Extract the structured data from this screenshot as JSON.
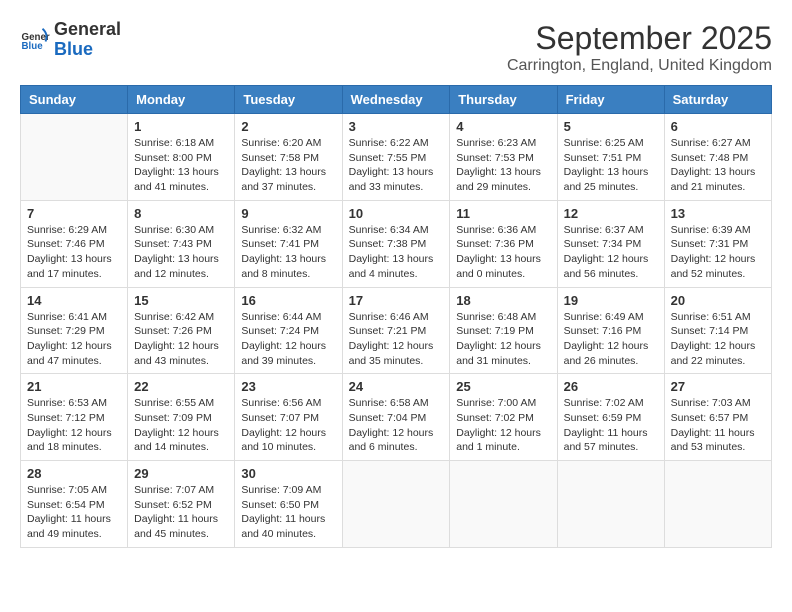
{
  "header": {
    "logo": {
      "general": "General",
      "blue": "Blue"
    },
    "title": "September 2025",
    "location": "Carrington, England, United Kingdom"
  },
  "calendar": {
    "days_of_week": [
      "Sunday",
      "Monday",
      "Tuesday",
      "Wednesday",
      "Thursday",
      "Friday",
      "Saturday"
    ],
    "weeks": [
      [
        {
          "day": "",
          "info": ""
        },
        {
          "day": "1",
          "info": "Sunrise: 6:18 AM\nSunset: 8:00 PM\nDaylight: 13 hours\nand 41 minutes."
        },
        {
          "day": "2",
          "info": "Sunrise: 6:20 AM\nSunset: 7:58 PM\nDaylight: 13 hours\nand 37 minutes."
        },
        {
          "day": "3",
          "info": "Sunrise: 6:22 AM\nSunset: 7:55 PM\nDaylight: 13 hours\nand 33 minutes."
        },
        {
          "day": "4",
          "info": "Sunrise: 6:23 AM\nSunset: 7:53 PM\nDaylight: 13 hours\nand 29 minutes."
        },
        {
          "day": "5",
          "info": "Sunrise: 6:25 AM\nSunset: 7:51 PM\nDaylight: 13 hours\nand 25 minutes."
        },
        {
          "day": "6",
          "info": "Sunrise: 6:27 AM\nSunset: 7:48 PM\nDaylight: 13 hours\nand 21 minutes."
        }
      ],
      [
        {
          "day": "7",
          "info": "Sunrise: 6:29 AM\nSunset: 7:46 PM\nDaylight: 13 hours\nand 17 minutes."
        },
        {
          "day": "8",
          "info": "Sunrise: 6:30 AM\nSunset: 7:43 PM\nDaylight: 13 hours\nand 12 minutes."
        },
        {
          "day": "9",
          "info": "Sunrise: 6:32 AM\nSunset: 7:41 PM\nDaylight: 13 hours\nand 8 minutes."
        },
        {
          "day": "10",
          "info": "Sunrise: 6:34 AM\nSunset: 7:38 PM\nDaylight: 13 hours\nand 4 minutes."
        },
        {
          "day": "11",
          "info": "Sunrise: 6:36 AM\nSunset: 7:36 PM\nDaylight: 13 hours\nand 0 minutes."
        },
        {
          "day": "12",
          "info": "Sunrise: 6:37 AM\nSunset: 7:34 PM\nDaylight: 12 hours\nand 56 minutes."
        },
        {
          "day": "13",
          "info": "Sunrise: 6:39 AM\nSunset: 7:31 PM\nDaylight: 12 hours\nand 52 minutes."
        }
      ],
      [
        {
          "day": "14",
          "info": "Sunrise: 6:41 AM\nSunset: 7:29 PM\nDaylight: 12 hours\nand 47 minutes."
        },
        {
          "day": "15",
          "info": "Sunrise: 6:42 AM\nSunset: 7:26 PM\nDaylight: 12 hours\nand 43 minutes."
        },
        {
          "day": "16",
          "info": "Sunrise: 6:44 AM\nSunset: 7:24 PM\nDaylight: 12 hours\nand 39 minutes."
        },
        {
          "day": "17",
          "info": "Sunrise: 6:46 AM\nSunset: 7:21 PM\nDaylight: 12 hours\nand 35 minutes."
        },
        {
          "day": "18",
          "info": "Sunrise: 6:48 AM\nSunset: 7:19 PM\nDaylight: 12 hours\nand 31 minutes."
        },
        {
          "day": "19",
          "info": "Sunrise: 6:49 AM\nSunset: 7:16 PM\nDaylight: 12 hours\nand 26 minutes."
        },
        {
          "day": "20",
          "info": "Sunrise: 6:51 AM\nSunset: 7:14 PM\nDaylight: 12 hours\nand 22 minutes."
        }
      ],
      [
        {
          "day": "21",
          "info": "Sunrise: 6:53 AM\nSunset: 7:12 PM\nDaylight: 12 hours\nand 18 minutes."
        },
        {
          "day": "22",
          "info": "Sunrise: 6:55 AM\nSunset: 7:09 PM\nDaylight: 12 hours\nand 14 minutes."
        },
        {
          "day": "23",
          "info": "Sunrise: 6:56 AM\nSunset: 7:07 PM\nDaylight: 12 hours\nand 10 minutes."
        },
        {
          "day": "24",
          "info": "Sunrise: 6:58 AM\nSunset: 7:04 PM\nDaylight: 12 hours\nand 6 minutes."
        },
        {
          "day": "25",
          "info": "Sunrise: 7:00 AM\nSunset: 7:02 PM\nDaylight: 12 hours\nand 1 minute."
        },
        {
          "day": "26",
          "info": "Sunrise: 7:02 AM\nSunset: 6:59 PM\nDaylight: 11 hours\nand 57 minutes."
        },
        {
          "day": "27",
          "info": "Sunrise: 7:03 AM\nSunset: 6:57 PM\nDaylight: 11 hours\nand 53 minutes."
        }
      ],
      [
        {
          "day": "28",
          "info": "Sunrise: 7:05 AM\nSunset: 6:54 PM\nDaylight: 11 hours\nand 49 minutes."
        },
        {
          "day": "29",
          "info": "Sunrise: 7:07 AM\nSunset: 6:52 PM\nDaylight: 11 hours\nand 45 minutes."
        },
        {
          "day": "30",
          "info": "Sunrise: 7:09 AM\nSunset: 6:50 PM\nDaylight: 11 hours\nand 40 minutes."
        },
        {
          "day": "",
          "info": ""
        },
        {
          "day": "",
          "info": ""
        },
        {
          "day": "",
          "info": ""
        },
        {
          "day": "",
          "info": ""
        }
      ]
    ]
  }
}
